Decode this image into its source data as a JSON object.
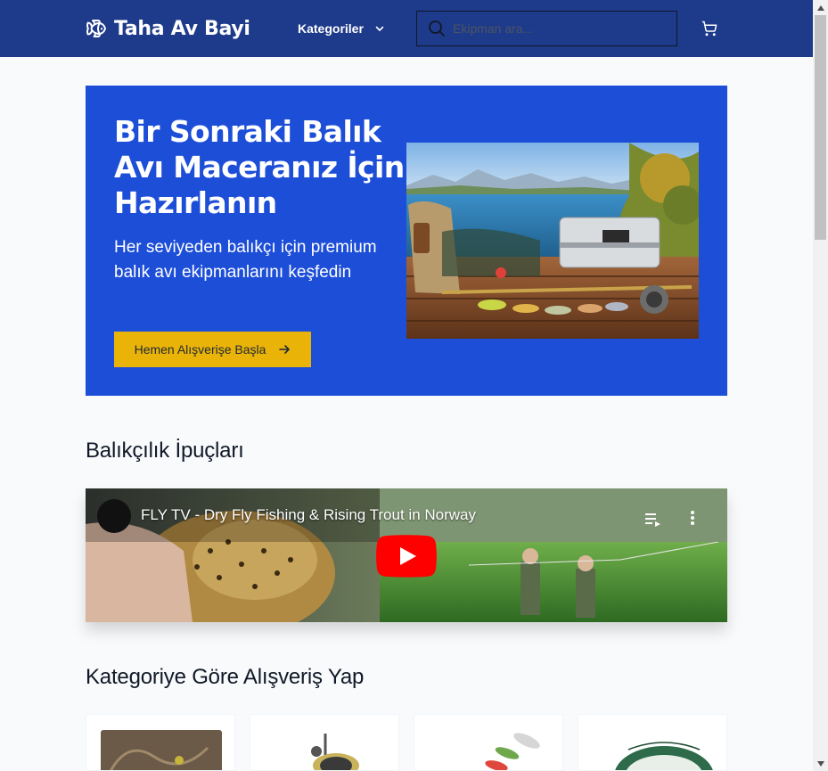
{
  "navbar": {
    "brand": "Taha Av Bayi",
    "categories_label": "Kategoriler",
    "search_placeholder": "Ekipman ara...",
    "colors": {
      "bg": "#1e3a8a",
      "text": "#ffffff"
    }
  },
  "hero": {
    "title": "Bir Sonraki Balık Avı Maceranız İçin Hazırlanın",
    "subtitle": "Her seviyeden balıkçı için premium balık avı ekipmanlarını keşfedin",
    "cta": "Hemen Alışverişe Başla",
    "colors": {
      "bg": "#1d4ed8",
      "cta_bg": "#eab308"
    }
  },
  "tips": {
    "title": "Balıkçılık İpuçları",
    "video_title": "FLY TV - Dry Fly Fishing & Rising Trout in Norway"
  },
  "categories": {
    "title": "Kategoriye Göre Alışveriş Yap"
  }
}
